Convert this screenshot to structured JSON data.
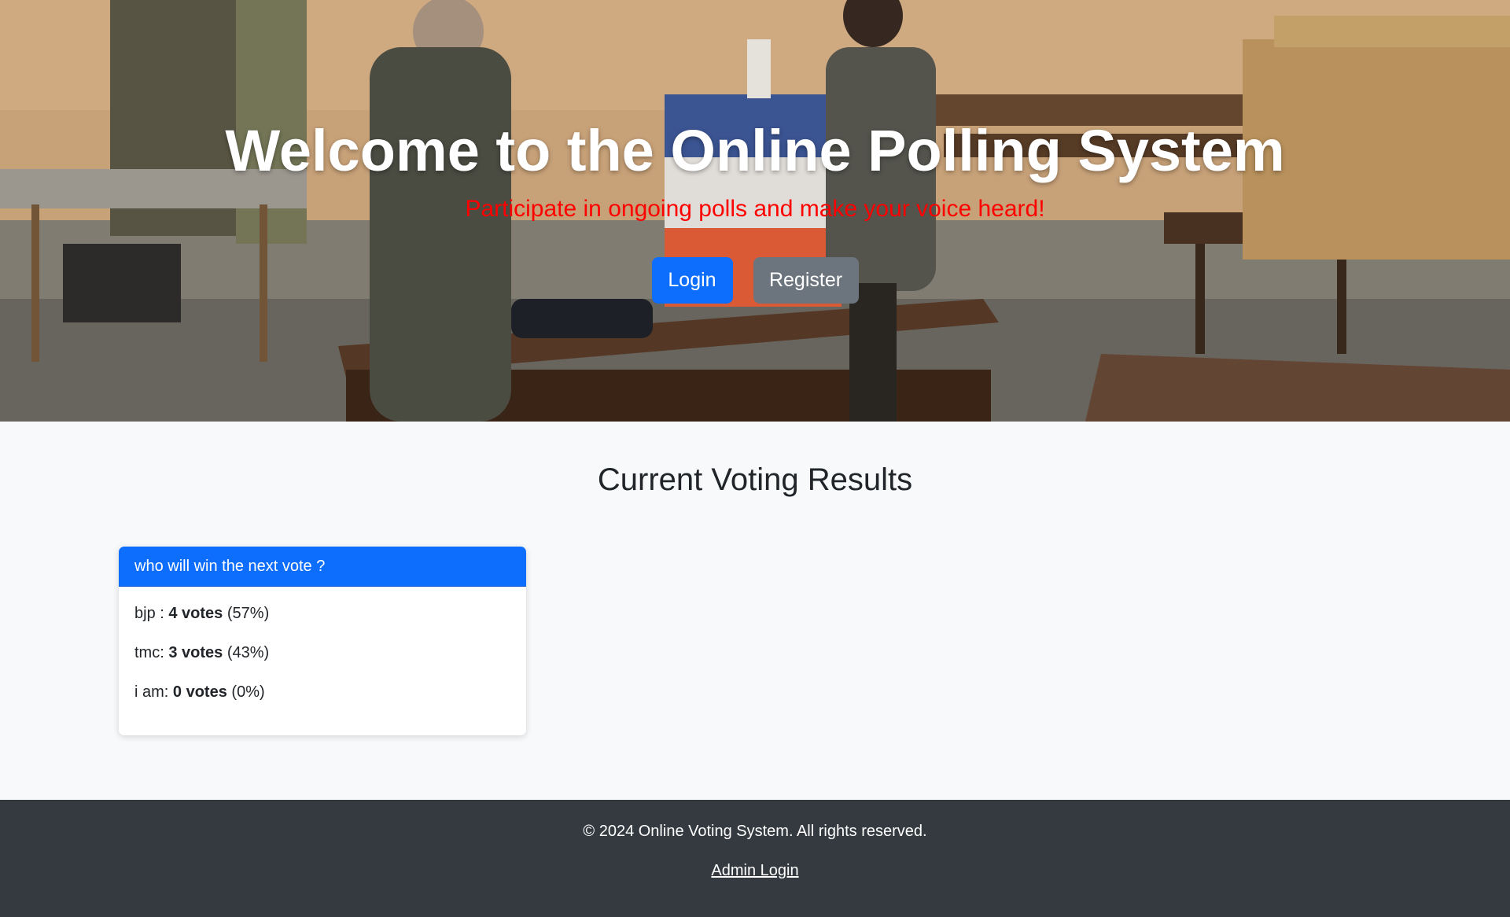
{
  "hero": {
    "title": "Welcome to the Online Polling System",
    "subtitle": "Participate in ongoing polls and make your voice heard!",
    "login_label": "Login",
    "register_label": "Register"
  },
  "results": {
    "title": "Current Voting Results",
    "polls": [
      {
        "question": "who will win the next vote ?",
        "options": [
          {
            "name": "bjp :",
            "votes": "4 votes",
            "percent": "(57%)"
          },
          {
            "name": "tmc:",
            "votes": "3 votes",
            "percent": "(43%)"
          },
          {
            "name": "i am:",
            "votes": "0 votes",
            "percent": "(0%)"
          }
        ]
      }
    ]
  },
  "footer": {
    "copyright": "© 2024 Online Voting System. All rights reserved.",
    "admin_link": "Admin Login"
  },
  "colors": {
    "primary": "#0d6efd",
    "secondary": "#6c757d",
    "subtitle_red": "#ff0000",
    "footer_bg": "#343a40",
    "page_bg": "#f8f9fa"
  }
}
